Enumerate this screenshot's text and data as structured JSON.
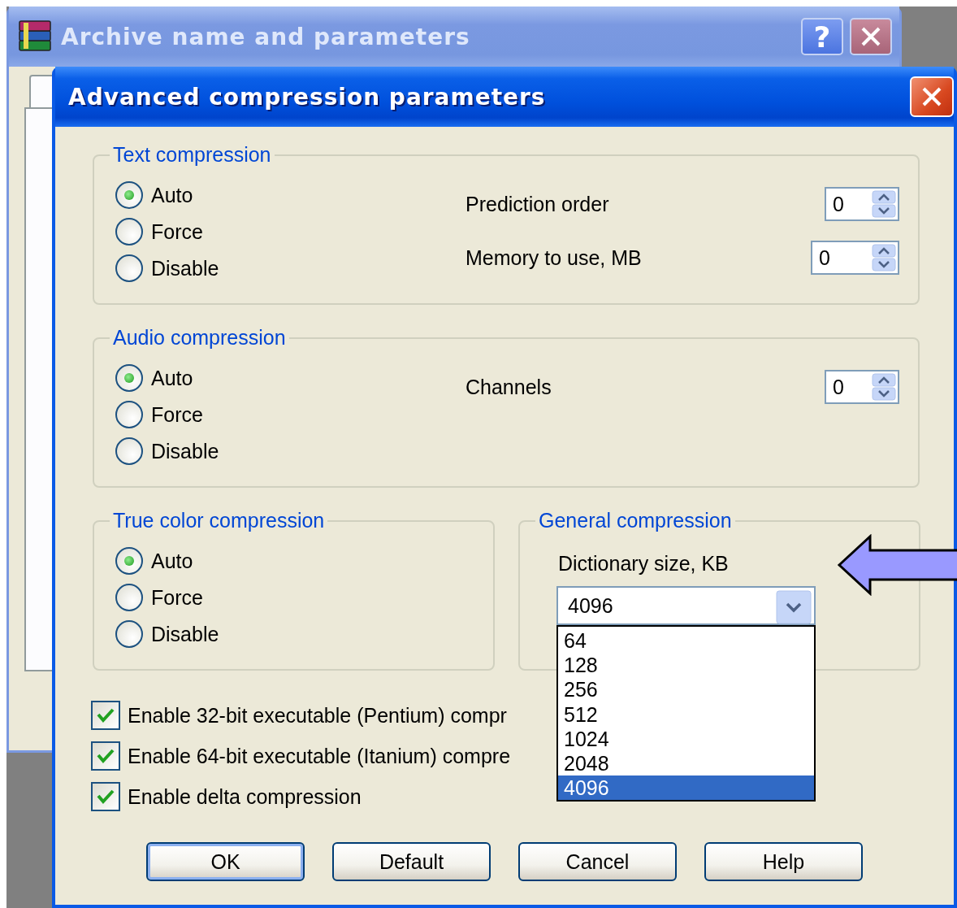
{
  "background_window": {
    "title": "Archive name and parameters",
    "help_button": "?"
  },
  "dialog": {
    "title": "Advanced compression parameters"
  },
  "groups": [
    {
      "title": "Text compression",
      "options": [
        {
          "label": "Auto",
          "selected": true
        },
        {
          "label": "Force",
          "selected": false
        },
        {
          "label": "Disable",
          "selected": false
        }
      ],
      "fields": [
        {
          "label": "Prediction order",
          "value": "0"
        },
        {
          "label": "Memory to use, MB",
          "value": "0"
        }
      ]
    },
    {
      "title": "Audio compression",
      "options": [
        {
          "label": "Auto",
          "selected": true
        },
        {
          "label": "Force",
          "selected": false
        },
        {
          "label": "Disable",
          "selected": false
        }
      ],
      "fields": [
        {
          "label": "Channels",
          "value": "0"
        }
      ]
    },
    {
      "title": "True color compression",
      "options": [
        {
          "label": "Auto",
          "selected": true
        },
        {
          "label": "Force",
          "selected": false
        },
        {
          "label": "Disable",
          "selected": false
        }
      ]
    }
  ],
  "general": {
    "title": "General compression",
    "label": "Dictionary size, KB",
    "value": "4096",
    "expanded": true,
    "options": [
      {
        "label": "64",
        "selected": false
      },
      {
        "label": "128",
        "selected": false
      },
      {
        "label": "256",
        "selected": false
      },
      {
        "label": "512",
        "selected": false
      },
      {
        "label": "1024",
        "selected": false
      },
      {
        "label": "2048",
        "selected": false
      },
      {
        "label": "4096",
        "selected": true
      }
    ]
  },
  "checkboxes": [
    {
      "label": "Enable 32-bit executable (Pentium) compr",
      "checked": true
    },
    {
      "label": "Enable 64-bit executable (Itanium) compre",
      "checked": true
    },
    {
      "label": "Enable delta compression",
      "checked": true
    }
  ],
  "buttons": [
    {
      "label": "OK",
      "default": true
    },
    {
      "label": "Default",
      "default": false
    },
    {
      "label": "Cancel",
      "default": false
    },
    {
      "label": "Help",
      "default": false
    }
  ]
}
